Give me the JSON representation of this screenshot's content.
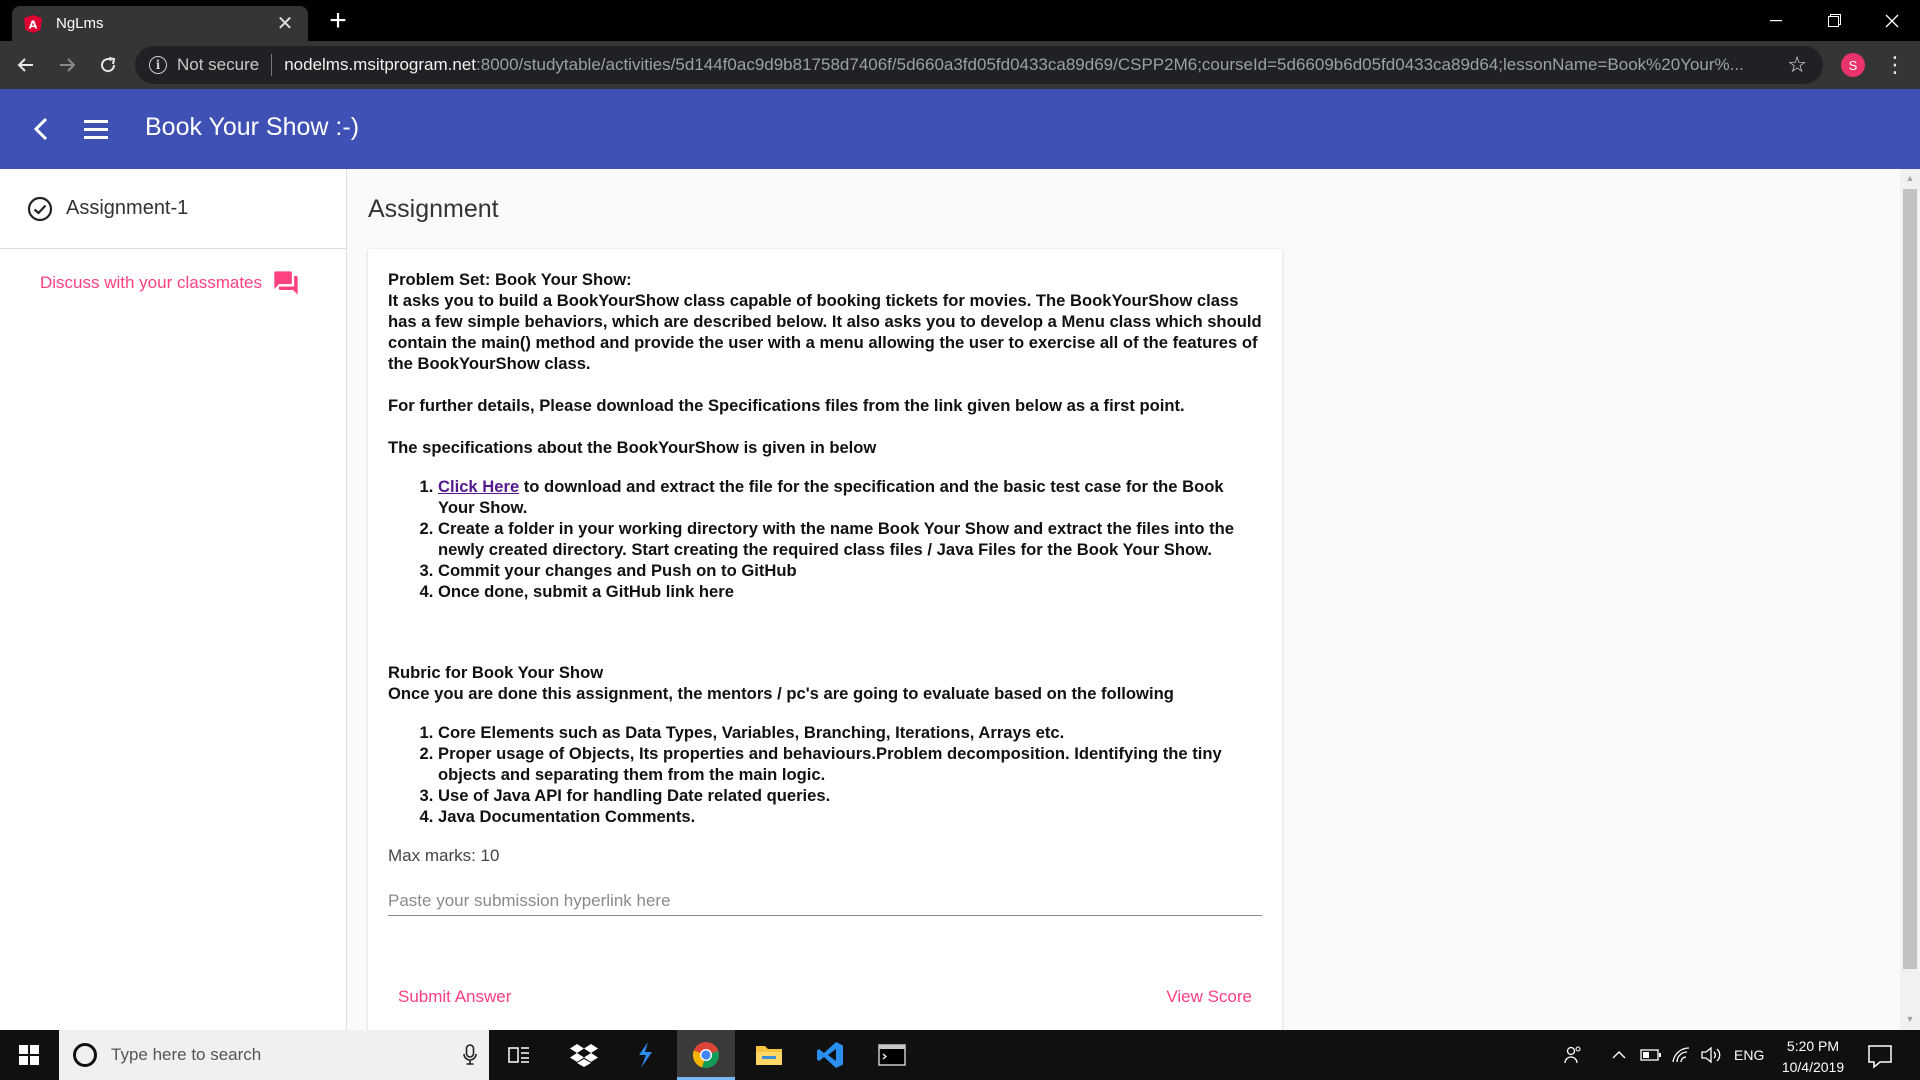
{
  "browser": {
    "tab_title": "NgLms",
    "tab_close": "✕",
    "new_tab": "+",
    "not_secure": "Not secure",
    "url_host": "nodelms.msitprogram.net",
    "url_path": ":8000/studytable/activities/5d144f0ac9d9b81758d7406f/5d660a3fd05fd0433ca89d69/CSPP2M6;courseId=5d6609b6d05fd0433ca89d64;lessonName=Book%20Your%...",
    "profile_initial": "S"
  },
  "appbar": {
    "title": "Book Your Show :-)"
  },
  "sidebar": {
    "assignment_label": "Assignment-1",
    "discuss_label": "Discuss with your classmates"
  },
  "main": {
    "section_title": "Assignment",
    "problem_heading": "Problem Set: Book Your Show:",
    "problem_desc": "It asks you to build a BookYourShow class capable of booking tickets for movies. The BookYourShow class has a few simple behaviors, which are described below. It also asks you to develop a Menu class which should contain the main() method and provide the user with a menu allowing the user to exercise all of the features of the BookYourShow class.",
    "further_details": "For further details, Please download the Specifications files from the link given below as a first point.",
    "spec_intro": "The specifications about the BookYourShow is given in below",
    "steps": {
      "s1_link": "Click Here",
      "s1_rest": " to download and extract the file for the specification and the basic test case for the Book Your Show.",
      "s2": "Create a folder in your working directory with the name Book Your Show and extract the files into the newly created directory. Start creating the required class files / Java Files for the Book Your Show.",
      "s3": "Commit your changes and Push on to GitHub",
      "s4": "Once done, submit a GitHub link here"
    },
    "rubric_heading": "Rubric for Book Your Show",
    "rubric_intro": "Once you are done this assignment, the mentors / pc's are going to evaluate based on the following",
    "rubric": {
      "r1": "Core Elements such as Data Types, Variables, Branching, Iterations, Arrays etc.",
      "r2": "Proper usage of Objects, Its properties and behaviours.Problem decomposition. Identifying the tiny objects and separating them from the main logic.",
      "r3": "Use of Java API for handling Date related queries.",
      "r4": "Java Documentation Comments."
    },
    "max_marks": "Max marks: 10",
    "submission_placeholder": "Paste your submission hyperlink here",
    "submit_label": "Submit Answer",
    "view_score_label": "View Score"
  },
  "taskbar": {
    "search_placeholder": "Type here to search",
    "lang": "ENG",
    "time": "5:20 PM",
    "date": "10/4/2019"
  },
  "colors": {
    "appbar": "#3f51b5",
    "accent": "#ff4081",
    "link": "#551a8b"
  }
}
